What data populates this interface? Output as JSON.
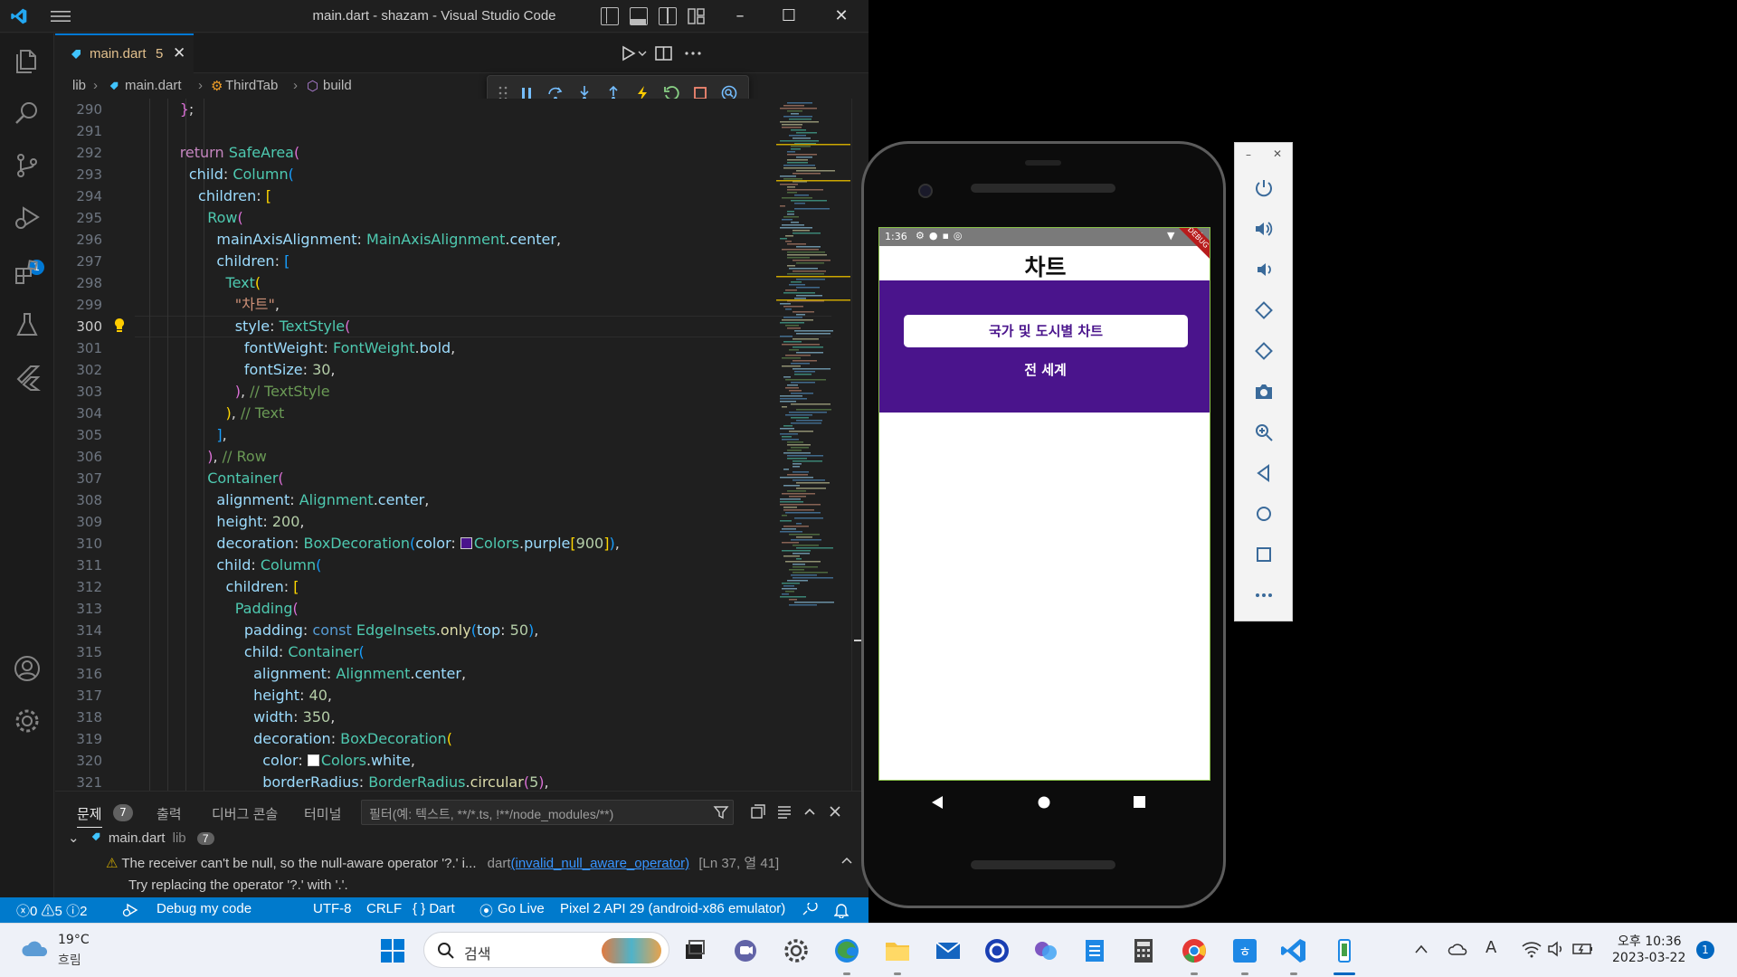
{
  "window": {
    "title": "main.dart - shazam - Visual Studio Code"
  },
  "activity": {
    "debug_badge": "1"
  },
  "tab": {
    "label": "main.dart",
    "problem_count": "5",
    "close": "✕"
  },
  "breadcrumb": {
    "items": [
      "lib",
      "main.dart",
      "ThirdTab",
      "build"
    ]
  },
  "editor": {
    "line_numbers": [
      "290",
      "291",
      "292",
      "293",
      "294",
      "295",
      "296",
      "297",
      "298",
      "299",
      "300",
      "301",
      "302",
      "303",
      "304",
      "305",
      "306",
      "307",
      "308",
      "309",
      "310",
      "311",
      "312",
      "313",
      "314",
      "315",
      "316",
      "317",
      "318",
      "319",
      "320",
      "321"
    ],
    "current_line": "300",
    "color_swatches": {
      "purple": "#4a148c",
      "white": "#ffffff"
    }
  },
  "panel": {
    "tabs": [
      "문제",
      "출력",
      "디버그 콘솔",
      "터미널"
    ],
    "problems_badge": "7",
    "filter_placeholder": "필터(예: 텍스트, **/*.ts, !**/node_modules/**)",
    "file_group": {
      "name": "main.dart",
      "folder": "lib",
      "count": "7"
    },
    "problem": {
      "message": "The receiver can't be null, so the null-aware operator '?.' i...",
      "source": "dart",
      "code": "(invalid_null_aware_operator)",
      "location": "[Ln 37, 열 41]",
      "hint": "Try replacing the operator '?.' with '.'."
    }
  },
  "statusbar": {
    "errors": "0",
    "warnings": "5",
    "infos": "2",
    "debug": "Debug my code",
    "encoding": "UTF-8",
    "eol": "CRLF",
    "language": "{ } Dart",
    "golive": "Go Live",
    "device": "Pixel 2 API 29 (android-x86 emulator)"
  },
  "phone": {
    "time": "1:36",
    "app_title": "차트",
    "button_label": "국가 및 도시별 차트",
    "subtitle": "전 세계",
    "ribbon": "DEBUG",
    "purple": "#4a148c"
  },
  "taskbar": {
    "weather_temp": "19°C",
    "weather_desc": "흐림",
    "search_label": "검색",
    "time": "오후 10:36",
    "date": "2023-03-22",
    "notification_count": "1"
  }
}
